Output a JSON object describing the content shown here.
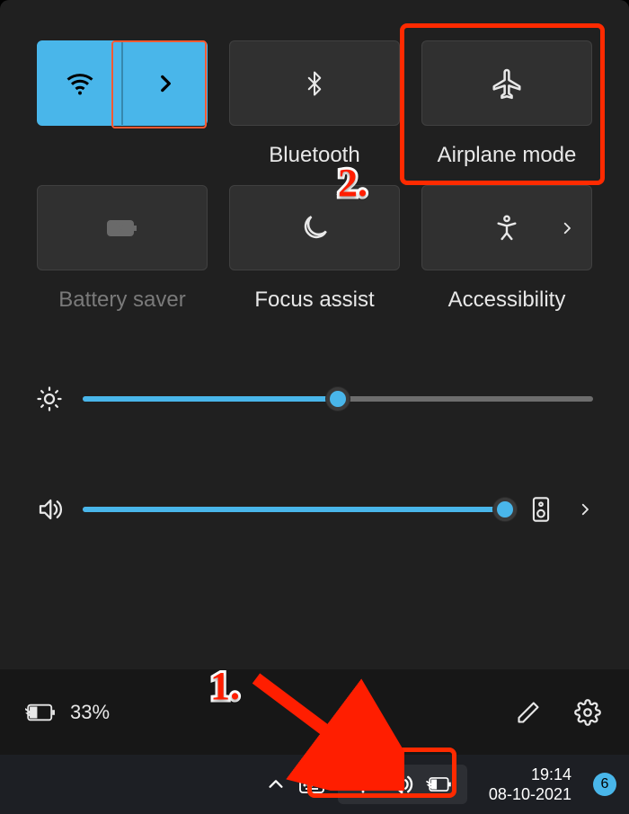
{
  "quick_settings": {
    "tiles": {
      "wifi": {
        "label": ""
      },
      "bluetooth": {
        "label": "Bluetooth"
      },
      "airplane": {
        "label": "Airplane mode"
      },
      "battery": {
        "label": "Battery saver"
      },
      "focus": {
        "label": "Focus assist"
      },
      "accessibility": {
        "label": "Accessibility"
      }
    },
    "sliders": {
      "brightness": {
        "percent": 50
      },
      "volume": {
        "percent": 100
      }
    },
    "footer": {
      "battery_text": "33%"
    }
  },
  "taskbar": {
    "time": "19:14",
    "date": "08-10-2021",
    "notification_count": "6"
  },
  "annotations": {
    "step1": "1.",
    "step2": "2."
  }
}
